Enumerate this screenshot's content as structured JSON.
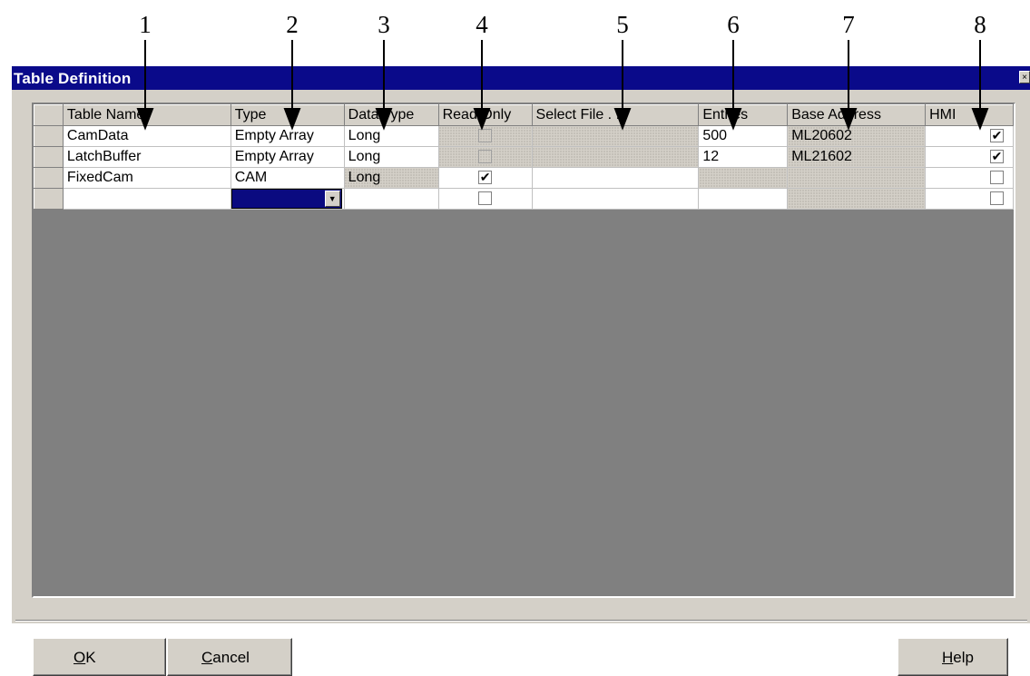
{
  "callouts": [
    "1",
    "2",
    "3",
    "4",
    "5",
    "6",
    "7",
    "8"
  ],
  "dialog": {
    "title": "Table Definition",
    "close_symbol": "×"
  },
  "columns": [
    "Table Name",
    "Type",
    "Data Type",
    "Read Only",
    "Select File . . .",
    "Entries",
    "Base Address",
    "HMI"
  ],
  "rows": [
    {
      "name": "CamData",
      "type": "Empty Array",
      "data_type": "Long",
      "read_only": false,
      "select_file": "",
      "entries": "500",
      "base_address": "ML20602",
      "hmi": true
    },
    {
      "name": "LatchBuffer",
      "type": "Empty Array",
      "data_type": "Long",
      "read_only": false,
      "select_file": "",
      "entries": "12",
      "base_address": "ML21602",
      "hmi": true
    },
    {
      "name": "FixedCam",
      "type": "CAM",
      "data_type": "Long",
      "read_only": true,
      "select_file": "",
      "entries": "",
      "base_address": "",
      "hmi": false
    },
    {
      "name": "",
      "type": "",
      "data_type": "",
      "read_only": false,
      "select_file": "",
      "entries": "",
      "base_address": "",
      "hmi": false
    }
  ],
  "check_symbol": "✔",
  "dropdown_arrow": "▼",
  "buttons": {
    "ok": {
      "mnemonic": "O",
      "rest": "K"
    },
    "cancel": {
      "mnemonic": "C",
      "rest": "ancel"
    },
    "help": {
      "mnemonic": "H",
      "rest": "elp"
    }
  }
}
